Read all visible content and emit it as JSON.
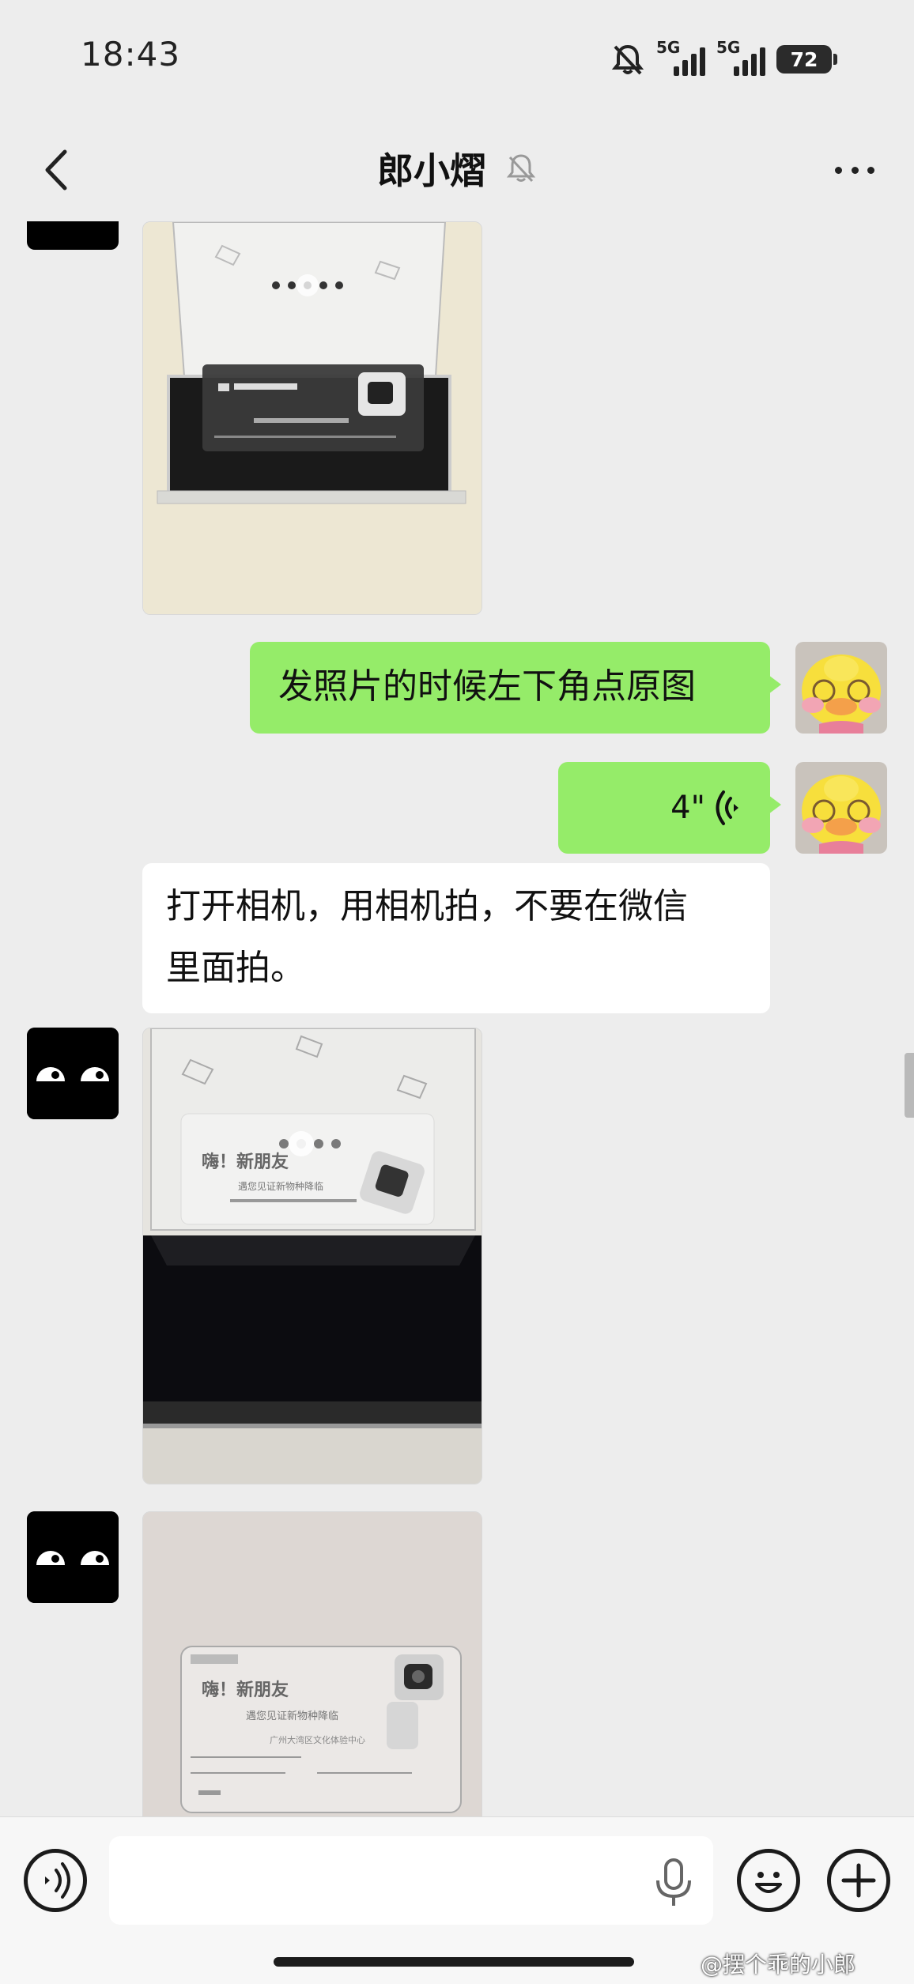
{
  "status_bar": {
    "time": "18:43",
    "network_1": "5G",
    "network_2": "5G",
    "battery": "72"
  },
  "header": {
    "title": "郎小熠"
  },
  "messages": {
    "text_1": "发照片的时候左下角点原图",
    "voice_duration": "4\"",
    "text_2_line_1": "打开相机，用相机拍，不要在微信",
    "text_2_line_2": "里面拍。"
  },
  "photo_text": {
    "photo_2_line_1": "嗨！新朋友",
    "photo_2_line_2": "遇您见证新物种降临",
    "photo_3_line_1": "嗨！新朋友",
    "photo_3_line_2": "遇您见证新物种降临",
    "photo_3_line_3": "广州大湾区文化体验中心"
  },
  "watermark": "@摆个乖的小郎",
  "icons": {
    "back": "chevron-left-icon",
    "mute": "bell-off-icon",
    "more": "more-dots-icon",
    "voice_toggle": "voice-icon",
    "mic": "mic-icon",
    "emoji": "emoji-icon",
    "add": "plus-icon"
  },
  "colors": {
    "outgoing_bubble": "#95ec69",
    "incoming_bubble": "#ffffff",
    "background": "#ededed"
  }
}
